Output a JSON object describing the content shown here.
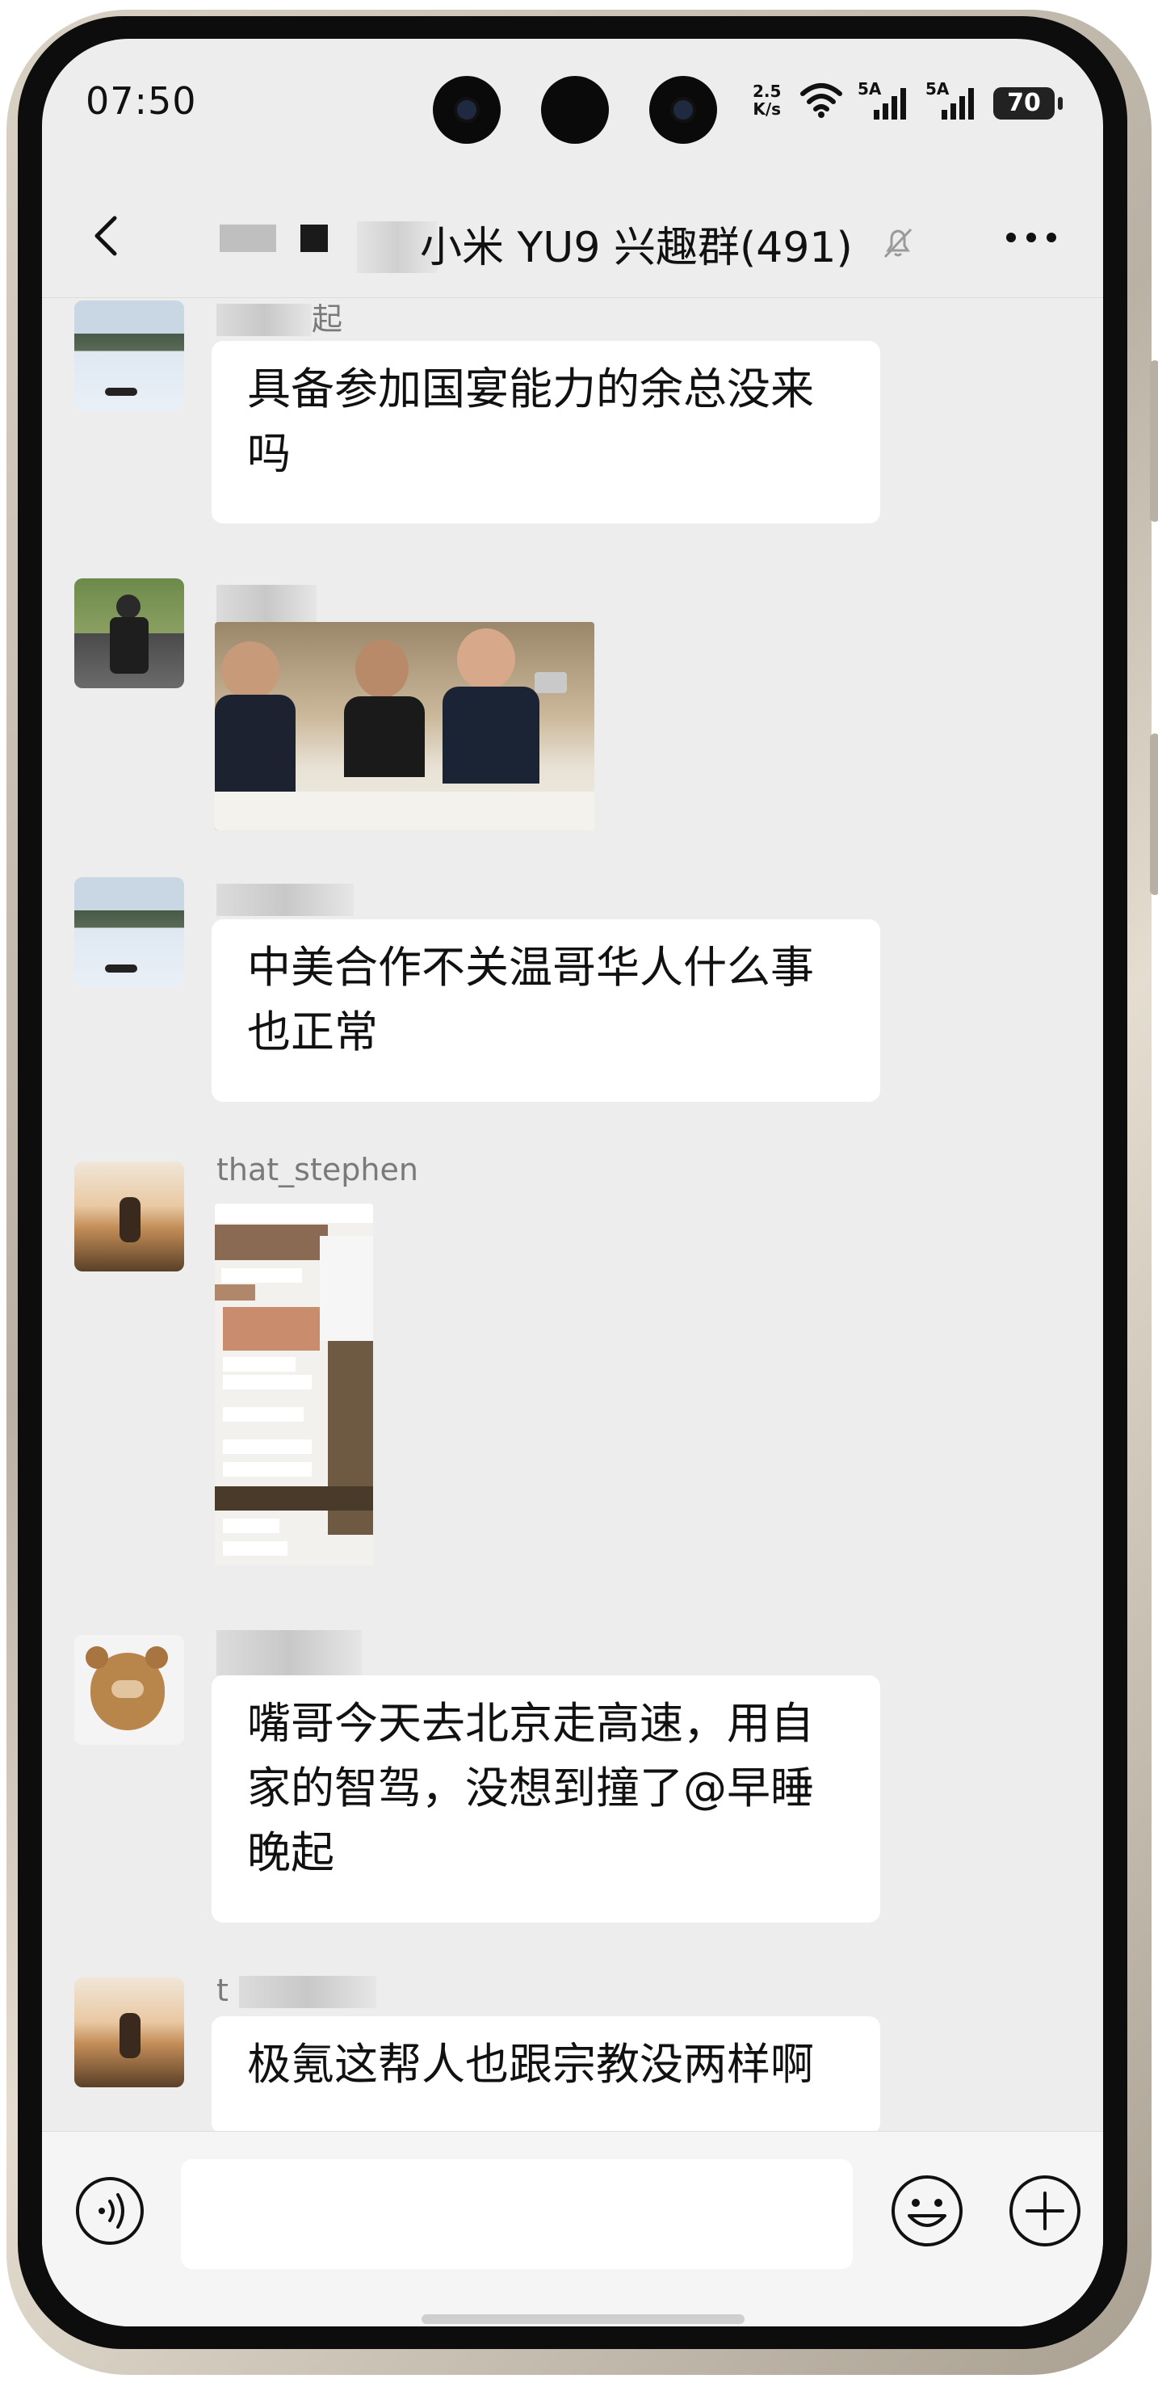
{
  "status_bar": {
    "time": "07:50",
    "net_speed_value": "2.5",
    "net_speed_unit": "K/s",
    "sim1_label": "5A",
    "sim2_label": "5A",
    "battery": "70"
  },
  "header": {
    "title": "小米 YU9 兴趣群(491)",
    "icons": [
      "back-arrow-icon",
      "mute-bell-icon",
      "more-dots-icon"
    ]
  },
  "messages": [
    {
      "sender": "起",
      "type": "text",
      "text_line1": "具备参加国宴能力的余总没来",
      "text_line2": "吗"
    },
    {
      "sender": "",
      "type": "image",
      "image_desc": "dinner-photo"
    },
    {
      "sender": "",
      "type": "text",
      "text_line1": "中美合作不关温哥华人什么事",
      "text_line2": "也正常"
    },
    {
      "sender": "that_stephen",
      "type": "image",
      "image_desc": "chat-screenshot"
    },
    {
      "sender": "",
      "type": "text",
      "text_line1": "嘴哥今天去北京走高速，用自",
      "text_line2": "家的智驾，没想到撞了@早睡",
      "text_line3": "晚起"
    },
    {
      "sender": "t",
      "type": "text",
      "text_line1": "极氪这帮人也跟宗教没两样啊"
    }
  ],
  "input_bar": {
    "icons": [
      "voice-icon",
      "emoji-icon",
      "plus-icon"
    ],
    "input_value": ""
  },
  "colors": {
    "screen_bg": "#ededed",
    "bubble_bg": "#ffffff",
    "text": "#111111",
    "name_text": "#7a7a7a"
  }
}
